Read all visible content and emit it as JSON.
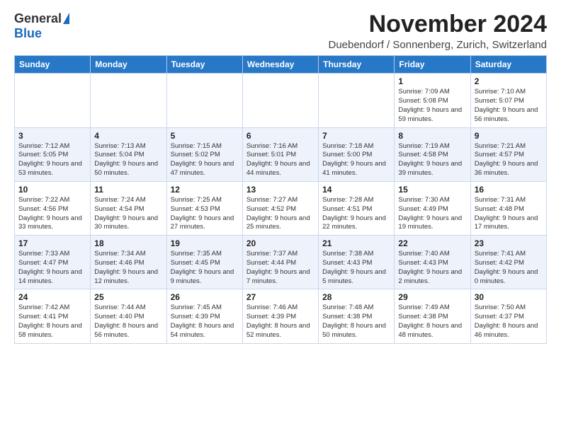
{
  "header": {
    "logo_general": "General",
    "logo_blue": "Blue",
    "month_title": "November 2024",
    "location": "Duebendorf / Sonnenberg, Zurich, Switzerland"
  },
  "weekdays": [
    "Sunday",
    "Monday",
    "Tuesday",
    "Wednesday",
    "Thursday",
    "Friday",
    "Saturday"
  ],
  "weeks": [
    [
      {
        "day": "",
        "info": ""
      },
      {
        "day": "",
        "info": ""
      },
      {
        "day": "",
        "info": ""
      },
      {
        "day": "",
        "info": ""
      },
      {
        "day": "",
        "info": ""
      },
      {
        "day": "1",
        "info": "Sunrise: 7:09 AM\nSunset: 5:08 PM\nDaylight: 9 hours and 59 minutes."
      },
      {
        "day": "2",
        "info": "Sunrise: 7:10 AM\nSunset: 5:07 PM\nDaylight: 9 hours and 56 minutes."
      }
    ],
    [
      {
        "day": "3",
        "info": "Sunrise: 7:12 AM\nSunset: 5:05 PM\nDaylight: 9 hours and 53 minutes."
      },
      {
        "day": "4",
        "info": "Sunrise: 7:13 AM\nSunset: 5:04 PM\nDaylight: 9 hours and 50 minutes."
      },
      {
        "day": "5",
        "info": "Sunrise: 7:15 AM\nSunset: 5:02 PM\nDaylight: 9 hours and 47 minutes."
      },
      {
        "day": "6",
        "info": "Sunrise: 7:16 AM\nSunset: 5:01 PM\nDaylight: 9 hours and 44 minutes."
      },
      {
        "day": "7",
        "info": "Sunrise: 7:18 AM\nSunset: 5:00 PM\nDaylight: 9 hours and 41 minutes."
      },
      {
        "day": "8",
        "info": "Sunrise: 7:19 AM\nSunset: 4:58 PM\nDaylight: 9 hours and 39 minutes."
      },
      {
        "day": "9",
        "info": "Sunrise: 7:21 AM\nSunset: 4:57 PM\nDaylight: 9 hours and 36 minutes."
      }
    ],
    [
      {
        "day": "10",
        "info": "Sunrise: 7:22 AM\nSunset: 4:56 PM\nDaylight: 9 hours and 33 minutes."
      },
      {
        "day": "11",
        "info": "Sunrise: 7:24 AM\nSunset: 4:54 PM\nDaylight: 9 hours and 30 minutes."
      },
      {
        "day": "12",
        "info": "Sunrise: 7:25 AM\nSunset: 4:53 PM\nDaylight: 9 hours and 27 minutes."
      },
      {
        "day": "13",
        "info": "Sunrise: 7:27 AM\nSunset: 4:52 PM\nDaylight: 9 hours and 25 minutes."
      },
      {
        "day": "14",
        "info": "Sunrise: 7:28 AM\nSunset: 4:51 PM\nDaylight: 9 hours and 22 minutes."
      },
      {
        "day": "15",
        "info": "Sunrise: 7:30 AM\nSunset: 4:49 PM\nDaylight: 9 hours and 19 minutes."
      },
      {
        "day": "16",
        "info": "Sunrise: 7:31 AM\nSunset: 4:48 PM\nDaylight: 9 hours and 17 minutes."
      }
    ],
    [
      {
        "day": "17",
        "info": "Sunrise: 7:33 AM\nSunset: 4:47 PM\nDaylight: 9 hours and 14 minutes."
      },
      {
        "day": "18",
        "info": "Sunrise: 7:34 AM\nSunset: 4:46 PM\nDaylight: 9 hours and 12 minutes."
      },
      {
        "day": "19",
        "info": "Sunrise: 7:35 AM\nSunset: 4:45 PM\nDaylight: 9 hours and 9 minutes."
      },
      {
        "day": "20",
        "info": "Sunrise: 7:37 AM\nSunset: 4:44 PM\nDaylight: 9 hours and 7 minutes."
      },
      {
        "day": "21",
        "info": "Sunrise: 7:38 AM\nSunset: 4:43 PM\nDaylight: 9 hours and 5 minutes."
      },
      {
        "day": "22",
        "info": "Sunrise: 7:40 AM\nSunset: 4:43 PM\nDaylight: 9 hours and 2 minutes."
      },
      {
        "day": "23",
        "info": "Sunrise: 7:41 AM\nSunset: 4:42 PM\nDaylight: 9 hours and 0 minutes."
      }
    ],
    [
      {
        "day": "24",
        "info": "Sunrise: 7:42 AM\nSunset: 4:41 PM\nDaylight: 8 hours and 58 minutes."
      },
      {
        "day": "25",
        "info": "Sunrise: 7:44 AM\nSunset: 4:40 PM\nDaylight: 8 hours and 56 minutes."
      },
      {
        "day": "26",
        "info": "Sunrise: 7:45 AM\nSunset: 4:39 PM\nDaylight: 8 hours and 54 minutes."
      },
      {
        "day": "27",
        "info": "Sunrise: 7:46 AM\nSunset: 4:39 PM\nDaylight: 8 hours and 52 minutes."
      },
      {
        "day": "28",
        "info": "Sunrise: 7:48 AM\nSunset: 4:38 PM\nDaylight: 8 hours and 50 minutes."
      },
      {
        "day": "29",
        "info": "Sunrise: 7:49 AM\nSunset: 4:38 PM\nDaylight: 8 hours and 48 minutes."
      },
      {
        "day": "30",
        "info": "Sunrise: 7:50 AM\nSunset: 4:37 PM\nDaylight: 8 hours and 46 minutes."
      }
    ]
  ]
}
